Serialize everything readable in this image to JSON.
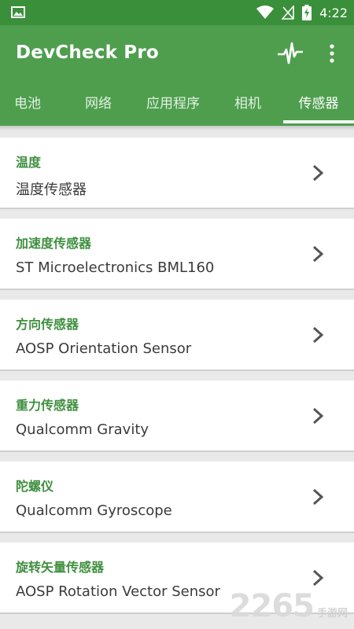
{
  "status_bar": {
    "time": "4:22",
    "icons": [
      "gallery-icon",
      "wifi-icon",
      "no-signal-icon",
      "battery-charging-icon"
    ]
  },
  "app": {
    "title": "DevCheck Pro",
    "actions": [
      "pulse-icon",
      "more-vert-icon"
    ]
  },
  "tabs": [
    {
      "label": "电池"
    },
    {
      "label": "网络"
    },
    {
      "label": "应用程序"
    },
    {
      "label": "相机"
    },
    {
      "label": "传感器",
      "active": true
    }
  ],
  "sensors": [
    {
      "title": "温度",
      "value": "温度传感器"
    },
    {
      "title": "加速度传感器",
      "value": "ST Microelectronics BML160"
    },
    {
      "title": "方向传感器",
      "value": "AOSP Orientation Sensor"
    },
    {
      "title": "重力传感器",
      "value": "Qualcomm Gravity"
    },
    {
      "title": "陀螺仪",
      "value": "Qualcomm Gyroscope"
    },
    {
      "title": "旋转矢量传感器",
      "value": "AOSP Rotation Vector Sensor"
    }
  ],
  "watermark": {
    "number": "2265",
    "text": "手游网"
  },
  "colors": {
    "primary": "#4e9e4e",
    "status_bar": "#3a8f3a",
    "accent_text": "#3f8f3f"
  }
}
